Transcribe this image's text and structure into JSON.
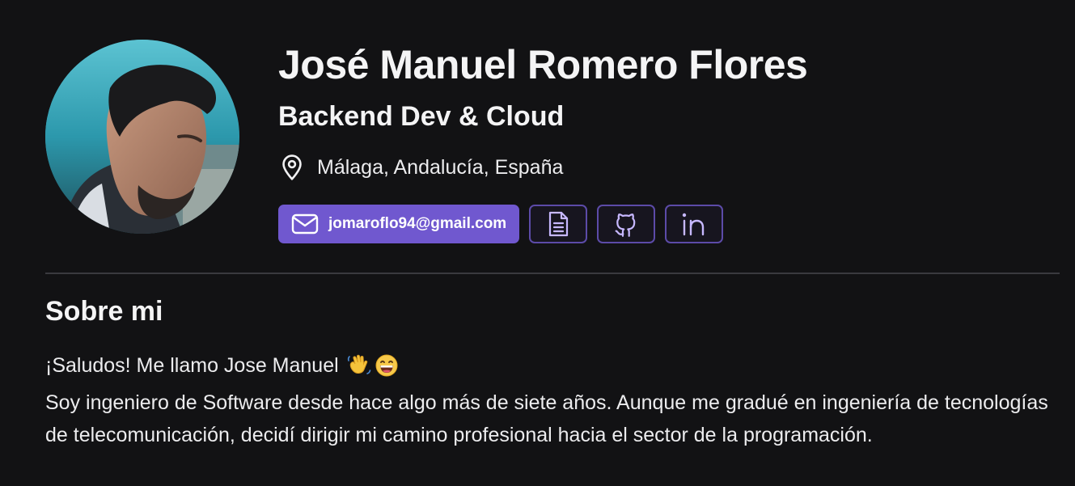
{
  "profile": {
    "name": "José Manuel Romero Flores",
    "role": "Backend Dev & Cloud",
    "location": "Málaga, Andalucía, España",
    "avatar_icon": "profile-photo"
  },
  "links": {
    "email": "jomaroflo94@gmail.com",
    "email_icon": "mail-icon",
    "cv_icon": "document-icon",
    "github_icon": "github-icon",
    "linkedin_icon": "linkedin-icon"
  },
  "about": {
    "title": "Sobre mi",
    "greeting": "¡Saludos! Me llamo Jose Manuel",
    "greeting_emojis": [
      "waving-hand-emoji",
      "grinning-face-emoji"
    ],
    "bio": "Soy ingeniero de Software desde hace algo más de siete años. Aunque me gradué en ingeniería de tecnologías de telecomunicación, decidí dirigir mi camino profesional hacia el sector de la programación."
  },
  "colors": {
    "background": "#121214",
    "accent": "#7058cf",
    "button_border": "#5c4ba8",
    "icon_accent": "#c7b8ff",
    "divider": "#3a3a3f"
  }
}
